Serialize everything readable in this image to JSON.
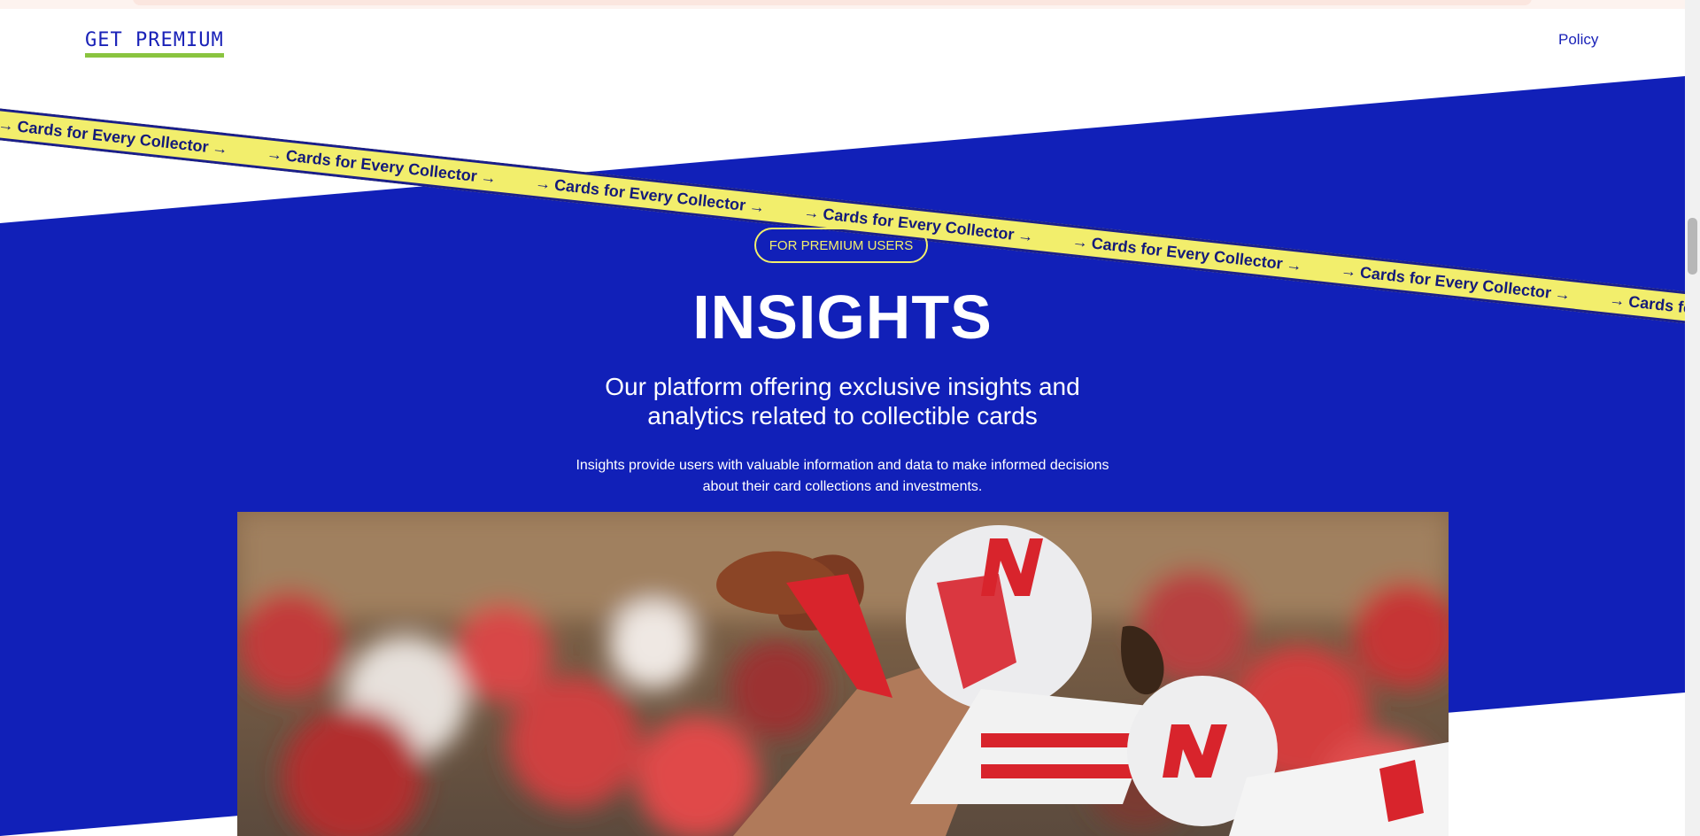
{
  "nav": {
    "cta_label": "GET PREMIUM",
    "policy_label": "Policy"
  },
  "ribbon": {
    "text": "Cards for Every Collector",
    "arrow": "→"
  },
  "hero": {
    "badge": "FOR PREMIUM USERS",
    "title": "INSIGHTS",
    "subtitle": "Our platform offering exclusive insights and analytics related to collectible cards",
    "description": "Insights provide users with valuable information and data to make informed decisions about their card collections and investments."
  },
  "colors": {
    "brand_blue": "#1120b8",
    "ribbon_yellow": "#f2ee6c",
    "accent_green": "#8ac43f"
  }
}
